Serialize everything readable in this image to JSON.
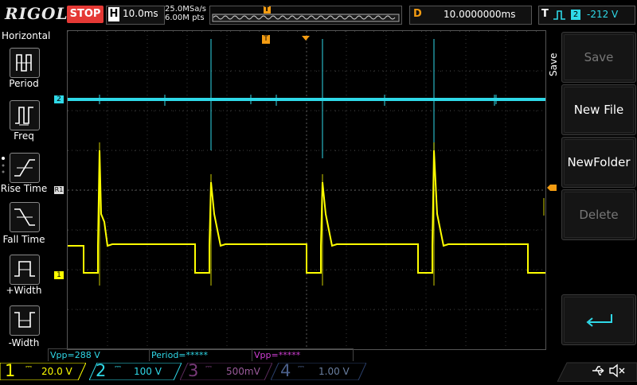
{
  "brand": "RIGOL",
  "status": "STOP",
  "horizontal": {
    "key": "H",
    "timebase": "10.0ms",
    "sample_rate": "25.0MSa/s",
    "memory_depth": "6.00M pts",
    "trigger_marker": "T"
  },
  "delay": {
    "key": "D",
    "value": "10.0000000ms"
  },
  "trigger": {
    "key": "T",
    "source": "2",
    "level": "-212 V"
  },
  "left_menu": {
    "title": "Horizontal",
    "items": [
      {
        "label": "Period"
      },
      {
        "label": "Freq"
      },
      {
        "label": "Rise Time"
      },
      {
        "label": "Fall Time"
      },
      {
        "label": "+Width"
      },
      {
        "label": "-Width"
      }
    ]
  },
  "right_menu": {
    "title": "Save",
    "items": [
      {
        "label": "Save",
        "enabled": false
      },
      {
        "label": "New File",
        "enabled": true
      },
      {
        "label": "NewFolder",
        "enabled": true
      },
      {
        "label": "Delete",
        "enabled": false
      }
    ]
  },
  "markers": {
    "ch2": "2",
    "ref": "R1",
    "ch1": "1",
    "trigger_top": "T"
  },
  "measurements": [
    {
      "text": "Vpp=288 V",
      "color": "#2fd9e8"
    },
    {
      "text": "Period=*****",
      "color": "#2fd9e8"
    },
    {
      "text": "Vpp=*****",
      "color": "#d23fd6"
    }
  ],
  "channels": [
    {
      "num": "1",
      "scale": "20.0 V",
      "color": "#ffff00",
      "active": true
    },
    {
      "num": "2",
      "scale": "100 V",
      "color": "#2fd9e8",
      "active": true
    },
    {
      "num": "3",
      "scale": "500mV",
      "color": "#d23fd6",
      "active": false
    },
    {
      "num": "4",
      "scale": "1.00 V",
      "color": "#3b6fd6",
      "active": false
    }
  ],
  "colors": {
    "ch1": "#ffff00",
    "ch2": "#2fd9e8",
    "accent": "#f39c12",
    "stop": "#e53935"
  },
  "icons": [
    "usb-icon",
    "speaker-muted-icon",
    "return-icon"
  ]
}
